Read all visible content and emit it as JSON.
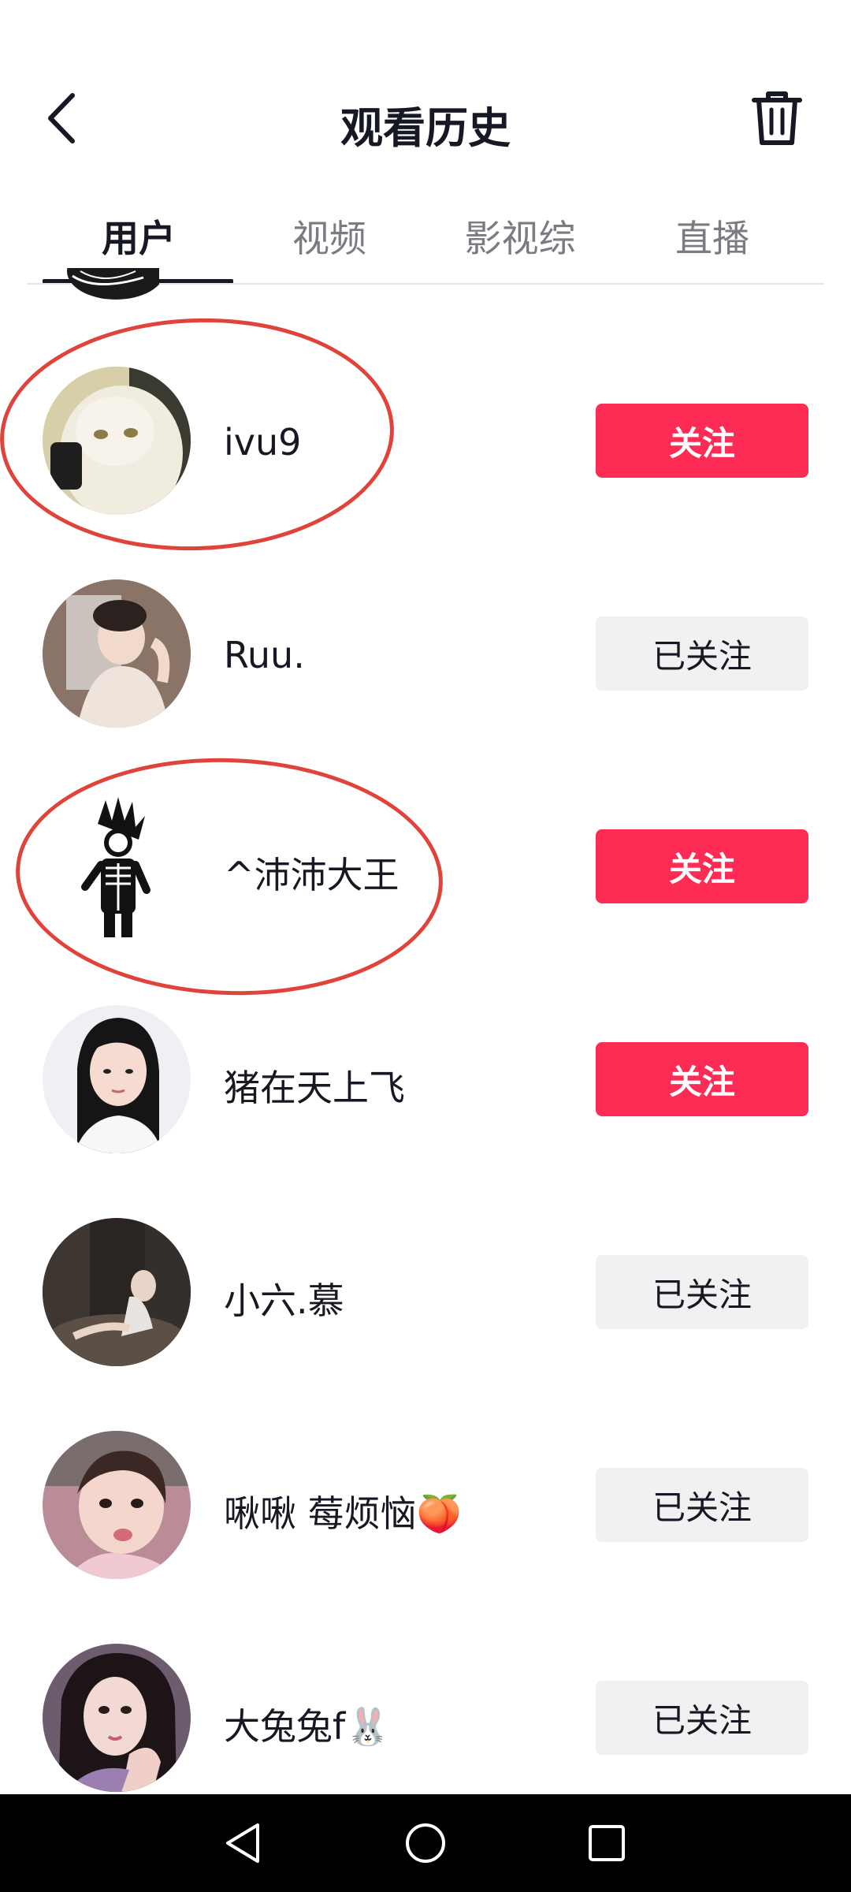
{
  "header": {
    "title": "观看历史"
  },
  "tabs": [
    {
      "label": "用户",
      "active": true
    },
    {
      "label": "视频",
      "active": false
    },
    {
      "label": "影视综",
      "active": false
    },
    {
      "label": "直播",
      "active": false
    }
  ],
  "users": [
    {
      "name": "ivu9",
      "button": "关注",
      "state": "follow"
    },
    {
      "name": "Ruu.",
      "button": "已关注",
      "state": "followed"
    },
    {
      "name": "^沛沛大王",
      "button": "关注",
      "state": "follow"
    },
    {
      "name": "猪在天上飞",
      "button": "关注",
      "state": "follow"
    },
    {
      "name": "小六.慕",
      "button": "已关注",
      "state": "followed"
    },
    {
      "name": "啾啾 莓烦恼🍑",
      "button": "已关注",
      "state": "followed"
    },
    {
      "name": "大兔兔f🐰",
      "button": "已关注",
      "state": "followed"
    }
  ],
  "colors": {
    "accent": "#fe2c55",
    "followed_bg": "#f1f1f2",
    "annotation": "#e0433a"
  },
  "icons": {
    "back": "chevron-left-icon",
    "trash": "trash-icon",
    "nav_back": "triangle-back-icon",
    "nav_home": "circle-home-icon",
    "nav_recent": "square-recents-icon"
  }
}
